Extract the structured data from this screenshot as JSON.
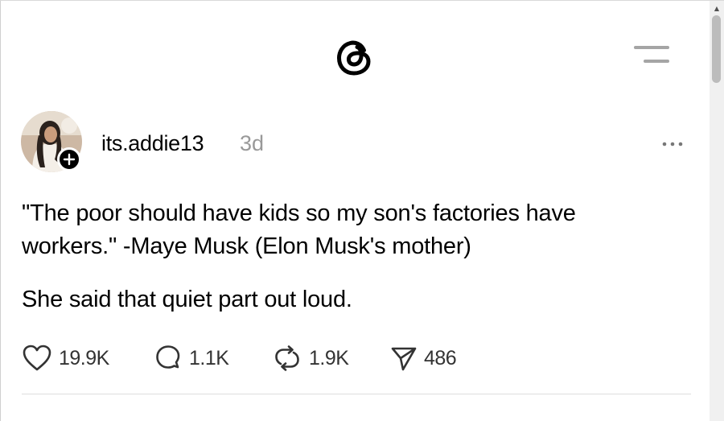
{
  "app": {
    "logo_icon": "threads-logo-icon",
    "menu_icon": "hamburger-menu-icon"
  },
  "post": {
    "username": "its.addie13",
    "timestamp": "3d",
    "text_line1": "\"The poor should have kids so my son's factories have workers.\" -Maye Musk (Elon Musk's mother)",
    "text_line2": "She said that quiet part out loud.",
    "actions": {
      "likes": "19.9K",
      "replies": "1.1K",
      "reposts": "1.9K",
      "shares": "486"
    }
  },
  "colors": {
    "text": "#000000",
    "muted": "#999999",
    "icon": "#a5a5a5"
  }
}
